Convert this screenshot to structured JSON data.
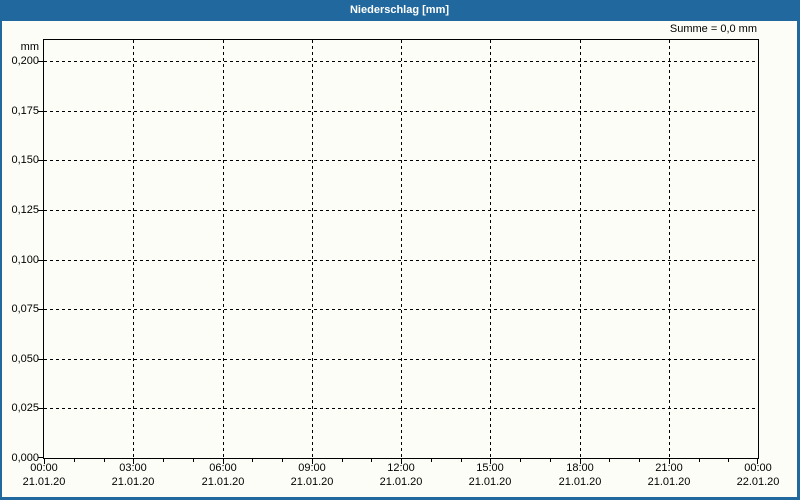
{
  "window": {
    "title": "Niederschlag [mm]"
  },
  "colors": {
    "accent_blue": "#21689e",
    "background": "#fdfdf8",
    "axis": "#000000",
    "title_text": "#ffffff"
  },
  "chart_data": {
    "type": "line",
    "title": "Niederschlag [mm]",
    "summary_annotation": "Summe = 0,0 mm",
    "grid": "dashed",
    "legend": "none",
    "series": [],
    "y_axis": {
      "unit_label": "mm",
      "min": 0.0,
      "max": 0.211,
      "tick_step": 0.025,
      "ticks": [
        {
          "value": 0.2,
          "label": "0,200"
        },
        {
          "value": 0.175,
          "label": "0,175"
        },
        {
          "value": 0.15,
          "label": "0,150"
        },
        {
          "value": 0.125,
          "label": "0,125"
        },
        {
          "value": 0.1,
          "label": "0,100"
        },
        {
          "value": 0.075,
          "label": "0,075"
        },
        {
          "value": 0.05,
          "label": "0,050"
        },
        {
          "value": 0.025,
          "label": "0,025"
        },
        {
          "value": 0.0,
          "label": "0,000"
        }
      ]
    },
    "x_axis": {
      "range_hours": [
        0,
        24
      ],
      "major_step_hours": 3,
      "minor_step_hours": 1,
      "ticks": [
        {
          "hour": 0,
          "time": "00:00",
          "date": "21.01.20"
        },
        {
          "hour": 3,
          "time": "03:00",
          "date": "21.01.20"
        },
        {
          "hour": 6,
          "time": "06:00",
          "date": "21.01.20"
        },
        {
          "hour": 9,
          "time": "09:00",
          "date": "21.01.20"
        },
        {
          "hour": 12,
          "time": "12:00",
          "date": "21.01.20"
        },
        {
          "hour": 15,
          "time": "15:00",
          "date": "21.01.20"
        },
        {
          "hour": 18,
          "time": "18:00",
          "date": "21.01.20"
        },
        {
          "hour": 21,
          "time": "21:00",
          "date": "21.01.20"
        },
        {
          "hour": 24,
          "time": "00:00",
          "date": "22.01.20"
        }
      ]
    }
  }
}
